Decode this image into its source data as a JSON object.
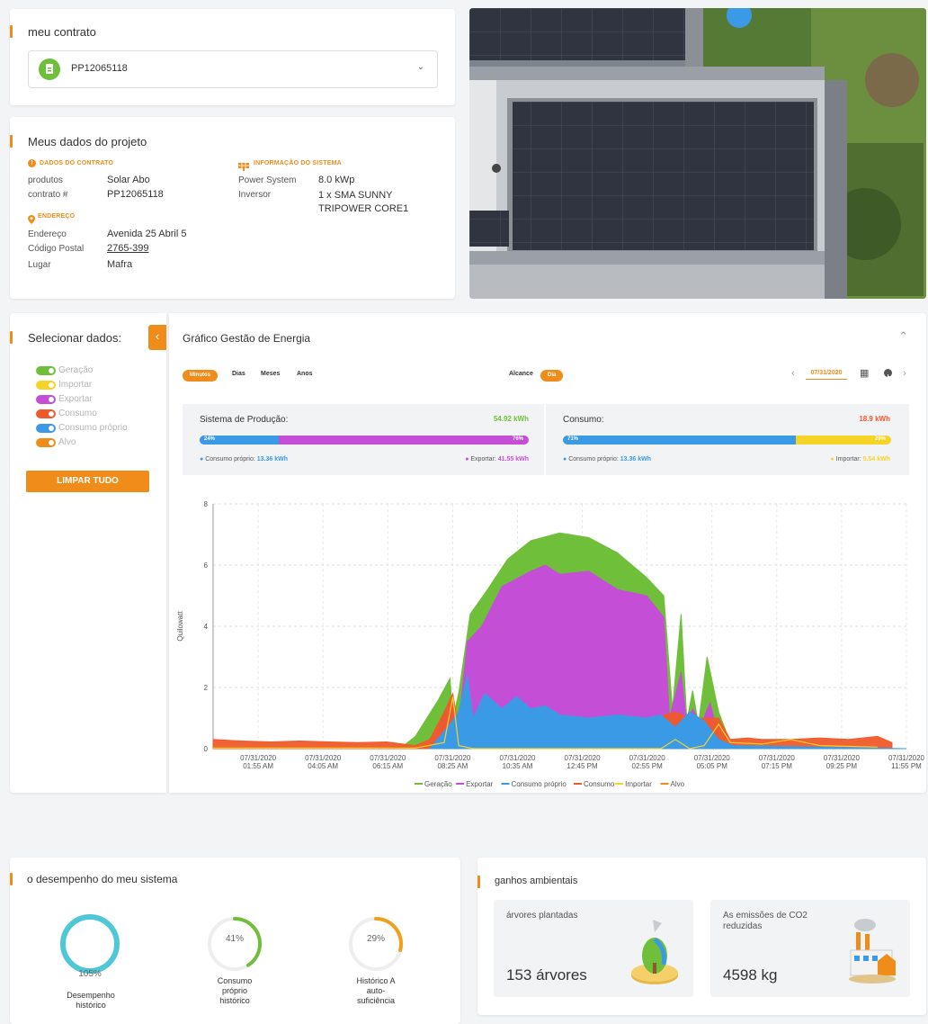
{
  "contract": {
    "title": "meu contrato",
    "selected": "PP12065118"
  },
  "project": {
    "title": "Meus dados do projeto",
    "contract_section": "DADOS DO CONTRATO",
    "system_section": "INFORMAÇÃO DO SISTEMA",
    "address_section": "ENDEREÇO",
    "rows": {
      "produtos_label": "produtos",
      "produtos_value": "Solar Abo",
      "contrato_label": "contrato #",
      "contrato_value": "PP12065118",
      "power_label": "Power System",
      "power_value": "8.0 kWp",
      "inversor_label": "Inversor",
      "inversor_value": "1 x SMA SUNNY TRIPOWER CORE1",
      "endereco_label": "Endereço",
      "endereco_value": "Avenida 25 Abril 5",
      "postal_label": "Código Postal",
      "postal_value": "2765-399",
      "lugar_label": "Lugar",
      "lugar_value": "Mafra"
    }
  },
  "sidebar": {
    "title": "Selecionar dados:",
    "items": [
      {
        "label": "Geração",
        "color": "#6fbf3b"
      },
      {
        "label": "Importar",
        "color": "#f5d327"
      },
      {
        "label": "Exportar",
        "color": "#c44fd6"
      },
      {
        "label": "Consumo",
        "color": "#f05a2a"
      },
      {
        "label": "Consumo próprio",
        "color": "#3b9ae6"
      },
      {
        "label": "Alvo",
        "color": "#f08c1a"
      }
    ],
    "clear_button": "LIMPAR TUDO"
  },
  "energy": {
    "title": "Gráfico Gestão de Energia",
    "tabs": [
      "Minutos",
      "Dias",
      "Meses",
      "Anos"
    ],
    "range_label": "Alcance",
    "range_value": "Dia",
    "date": "07/31/2020",
    "production": {
      "title": "Sistema de Produção:",
      "total": "54.92 kWh",
      "left_pct": "24%",
      "right_pct": "76%",
      "left_fraction": 0.24,
      "left_label": "Consumo próprio:",
      "left_value": "13.36 kWh",
      "right_label": "Exportar:",
      "right_value": "41.55 kWh"
    },
    "consumption": {
      "title": "Consumo:",
      "total": "18.9 kWh",
      "left_pct": "71%",
      "right_pct": "29%",
      "left_fraction": 0.71,
      "left_label": "Consumo próprio:",
      "left_value": "13.36 kWh",
      "right_label": "Importar:",
      "right_value": "5.54 kWh"
    }
  },
  "chart_data": {
    "type": "area",
    "ylabel": "Quilowatt",
    "ylim": [
      0,
      8
    ],
    "yticks": [
      0,
      2,
      4,
      6,
      8
    ],
    "xticks": [
      [
        "07/31/2020",
        "01:55 AM"
      ],
      [
        "07/31/2020",
        "04:05 AM"
      ],
      [
        "07/31/2020",
        "06:15 AM"
      ],
      [
        "07/31/2020",
        "08:25 AM"
      ],
      [
        "07/31/2020",
        "10:35 AM"
      ],
      [
        "07/31/2020",
        "12:45 PM"
      ],
      [
        "07/31/2020",
        "02:55 PM"
      ],
      [
        "07/31/2020",
        "05:05 PM"
      ],
      [
        "07/31/2020",
        "07:15 PM"
      ],
      [
        "07/31/2020",
        "09:25 PM"
      ],
      [
        "07/31/2020",
        "11:55 PM"
      ]
    ],
    "grid": true,
    "legend_position": "bottom",
    "series": [
      {
        "name": "Geração",
        "color": "#6fbf3b",
        "points": [
          [
            6,
            0
          ],
          [
            6.6,
            0.1
          ],
          [
            7,
            0.4
          ],
          [
            7.4,
            1.0
          ],
          [
            7.8,
            1.6
          ],
          [
            8.2,
            2.3
          ],
          [
            8.3,
            1.0
          ],
          [
            8.5,
            1.8
          ],
          [
            8.9,
            4.4
          ],
          [
            9.5,
            5.2
          ],
          [
            10.2,
            6.2
          ],
          [
            11,
            6.8
          ],
          [
            12,
            7.05
          ],
          [
            13,
            6.9
          ],
          [
            14,
            6.4
          ],
          [
            15,
            5.6
          ],
          [
            15.6,
            5.0
          ],
          [
            15.9,
            1.3
          ],
          [
            16.2,
            4.4
          ],
          [
            16.4,
            0.9
          ],
          [
            16.6,
            1.9
          ],
          [
            16.8,
            0.8
          ],
          [
            17.1,
            3.0
          ],
          [
            17.5,
            1.2
          ],
          [
            17.9,
            0.2
          ],
          [
            18.3,
            0
          ],
          [
            24,
            0
          ]
        ]
      },
      {
        "name": "Exportar",
        "color": "#c44fd6",
        "points": [
          [
            7.5,
            0
          ],
          [
            8,
            1.2
          ],
          [
            8.2,
            1.6
          ],
          [
            8.5,
            0.8
          ],
          [
            8.8,
            3.5
          ],
          [
            9.3,
            4.0
          ],
          [
            10,
            5.3
          ],
          [
            11,
            5.8
          ],
          [
            11.5,
            6.0
          ],
          [
            12,
            5.7
          ],
          [
            13,
            5.8
          ],
          [
            14,
            5.2
          ],
          [
            15,
            5.0
          ],
          [
            15.6,
            4.3
          ],
          [
            15.8,
            1.0
          ],
          [
            16.2,
            2.5
          ],
          [
            16.4,
            0.8
          ],
          [
            16.6,
            1.3
          ],
          [
            16.9,
            0.8
          ],
          [
            17.2,
            1.5
          ],
          [
            17.5,
            0.4
          ],
          [
            17.8,
            0
          ],
          [
            24,
            0
          ]
        ]
      },
      {
        "name": "Consumo próprio",
        "color": "#3b9ae6",
        "points": [
          [
            7.5,
            0
          ],
          [
            8.2,
            0.8
          ],
          [
            8.5,
            1.2
          ],
          [
            8.8,
            2.4
          ],
          [
            9.0,
            1.0
          ],
          [
            9.4,
            1.8
          ],
          [
            10,
            1.3
          ],
          [
            10.5,
            1.7
          ],
          [
            11,
            1.3
          ],
          [
            11.5,
            1.4
          ],
          [
            12,
            1.1
          ],
          [
            13,
            1.0
          ],
          [
            14,
            1.1
          ],
          [
            15,
            1.0
          ],
          [
            15.5,
            1.1
          ],
          [
            16,
            0.7
          ],
          [
            16.5,
            1.2
          ],
          [
            17,
            0.9
          ],
          [
            17.5,
            0.3
          ],
          [
            18,
            0.1
          ],
          [
            24,
            0
          ]
        ]
      },
      {
        "name": "Consumo",
        "color": "#f05a2a",
        "points": [
          [
            0,
            0.3
          ],
          [
            1,
            0.25
          ],
          [
            2,
            0.22
          ],
          [
            3,
            0.25
          ],
          [
            4,
            0.22
          ],
          [
            5,
            0.2
          ],
          [
            6,
            0.22
          ],
          [
            7,
            0.1
          ],
          [
            7.5,
            0.3
          ],
          [
            8,
            1.2
          ],
          [
            8.3,
            1.8
          ],
          [
            8.5,
            0.6
          ],
          [
            9,
            0.4
          ],
          [
            15,
            0.4
          ],
          [
            15.6,
            1.1
          ],
          [
            16,
            1.2
          ],
          [
            16.5,
            1.0
          ],
          [
            17,
            1.0
          ],
          [
            17.5,
            1.0
          ],
          [
            17.9,
            0.3
          ],
          [
            18.5,
            0.35
          ],
          [
            19,
            0.3
          ],
          [
            20,
            0.3
          ],
          [
            21,
            0.35
          ],
          [
            22,
            0.3
          ],
          [
            23,
            0.4
          ],
          [
            23.5,
            0.2
          ]
        ]
      },
      {
        "name": "Importar",
        "color": "#f5d327",
        "points": [
          [
            0,
            0.02
          ],
          [
            7,
            0.02
          ],
          [
            8,
            0.2
          ],
          [
            8.3,
            1.7
          ],
          [
            8.5,
            0.1
          ],
          [
            9,
            0
          ],
          [
            15.5,
            0
          ],
          [
            16,
            0.3
          ],
          [
            16.5,
            0
          ],
          [
            17,
            0.1
          ],
          [
            17.5,
            0.8
          ],
          [
            17.9,
            0.2
          ],
          [
            19,
            0.15
          ],
          [
            20,
            0.3
          ],
          [
            21,
            0.1
          ],
          [
            23,
            0.05
          ]
        ]
      },
      {
        "name": "Alvo",
        "color": "#f08c1a",
        "points": []
      }
    ]
  },
  "performance": {
    "title": "o desempenho do meu sistema",
    "gauges": [
      {
        "value": "105%",
        "fraction": 1.0,
        "color": "#4ec8d6",
        "label1": "Desempenho",
        "label2": "histórico",
        "label3": ""
      },
      {
        "value": "41%",
        "fraction": 0.41,
        "color": "#6fbf3b",
        "label1": "Consumo",
        "label2": "próprio",
        "label3": "histórico"
      },
      {
        "value": "29%",
        "fraction": 0.29,
        "color": "#f0a01a",
        "label1": "Histórico A",
        "label2": "auto-",
        "label3": "suficiência"
      }
    ]
  },
  "environment": {
    "title": "ganhos ambientais",
    "trees_label": "árvores plantadas",
    "trees_value": "153 árvores",
    "co2_label": "As emissões de CO2 reduzidas",
    "co2_value": "4598 kg"
  }
}
